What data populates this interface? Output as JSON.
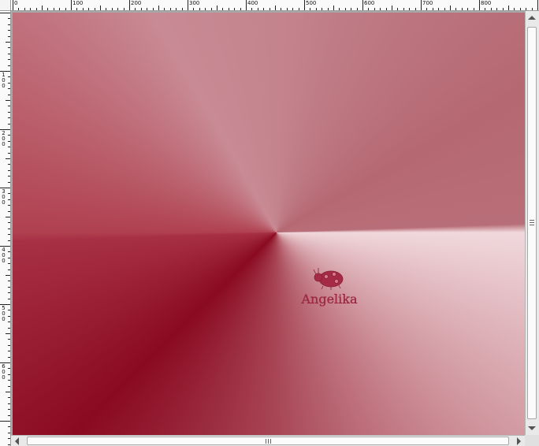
{
  "rulers": {
    "horizontal_labels": [
      "0",
      "100",
      "200",
      "300",
      "400",
      "500",
      "600",
      "700",
      "800"
    ],
    "vertical_labels": [
      "1\n0\n0",
      "2\n0\n0",
      "3\n0\n0",
      "4\n0\n0",
      "5\n0\n0",
      "6\n0\n0"
    ]
  },
  "canvas": {
    "gradient_type": "conic",
    "colors": {
      "light": "#f0d8dc",
      "mid": "#c4848e",
      "dark": "#8a0a22"
    },
    "watermark_text": "Angelika"
  },
  "scrollbars": {
    "vertical_grip": "≡",
    "horizontal_grip": "|||"
  }
}
